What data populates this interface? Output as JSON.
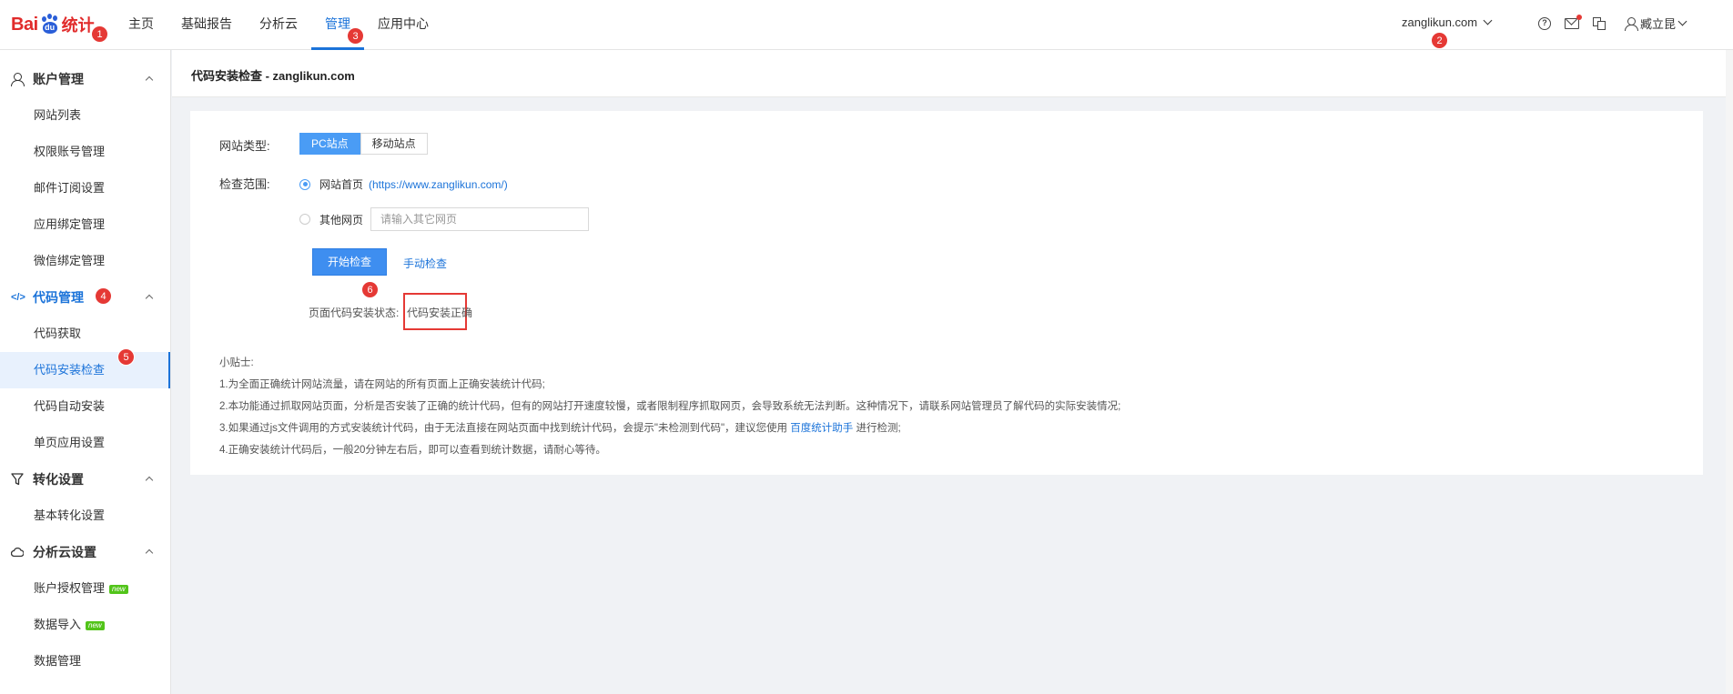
{
  "logo": {
    "part1": "Bai",
    "paw": "du",
    "part2": "统计"
  },
  "top_nav": [
    {
      "label": "主页"
    },
    {
      "label": "基础报告"
    },
    {
      "label": "分析云"
    },
    {
      "label": "管理"
    },
    {
      "label": "应用中心"
    }
  ],
  "top_nav_active": "管理",
  "site_selector": {
    "value": "zanglikun.com"
  },
  "user": {
    "name": "臧立昆"
  },
  "help_icon_glyph": "?",
  "badges": [
    "1",
    "2",
    "3",
    "4",
    "5",
    "6"
  ],
  "sidebar": {
    "groups": [
      {
        "title": "账户管理",
        "icon": "user-icon",
        "items": [
          "网站列表",
          "权限账号管理",
          "邮件订阅设置",
          "应用绑定管理",
          "微信绑定管理"
        ]
      },
      {
        "title": "代码管理",
        "icon": "code-icon",
        "icon_glyph": "</>",
        "items": [
          "代码获取",
          "代码安装检查",
          "代码自动安装",
          "单页应用设置"
        ]
      },
      {
        "title": "转化设置",
        "icon": "filter-icon",
        "items": [
          "基本转化设置"
        ]
      },
      {
        "title": "分析云设置",
        "icon": "cloud-icon",
        "items": [
          "账户授权管理",
          "数据导入",
          "数据管理"
        ]
      }
    ],
    "active_item": "代码安装检查",
    "new_tag": "new"
  },
  "page": {
    "title": "代码安装检查 - zanglikun.com",
    "site_type_label": "网站类型:",
    "site_type_options": [
      "PC站点",
      "移动站点"
    ],
    "site_type_selected": "PC站点",
    "scope_label": "检查范围:",
    "scope_home_label": "网站首页",
    "scope_home_url": "(https://www.zanglikun.com/)",
    "scope_other_label": "其他网页",
    "scope_other_placeholder": "请输入其它网页",
    "start_button": "开始检查",
    "manual_link": "手动检查",
    "status_label": "页面代码安装状态:",
    "status_value": "代码安装正确",
    "tips_title": "小贴士:",
    "tip1": "1.为全面正确统计网站流量，请在网站的所有页面上正确安装统计代码;",
    "tip2": "2.本功能通过抓取网站页面，分析是否安装了正确的统计代码，但有的网站打开速度较慢，或者限制程序抓取网页，会导致系统无法判断。这种情况下，请联系网站管理员了解代码的实际安装情况;",
    "tip3_pre": "3.如果通过js文件调用的方式安装统计代码，由于无法直接在网站页面中找到统计代码，会提示\"未检测到代码\"，建议您使用",
    "tip3_link": "百度统计助手",
    "tip3_post": "进行检测;",
    "tip4": "4.正确安装统计代码后，一般20分钟左右后，即可以查看到统计数据，请耐心等待。"
  },
  "colors": {
    "accent": "#1b73d9",
    "badge": "#e53935",
    "button": "#3e8ef0"
  }
}
